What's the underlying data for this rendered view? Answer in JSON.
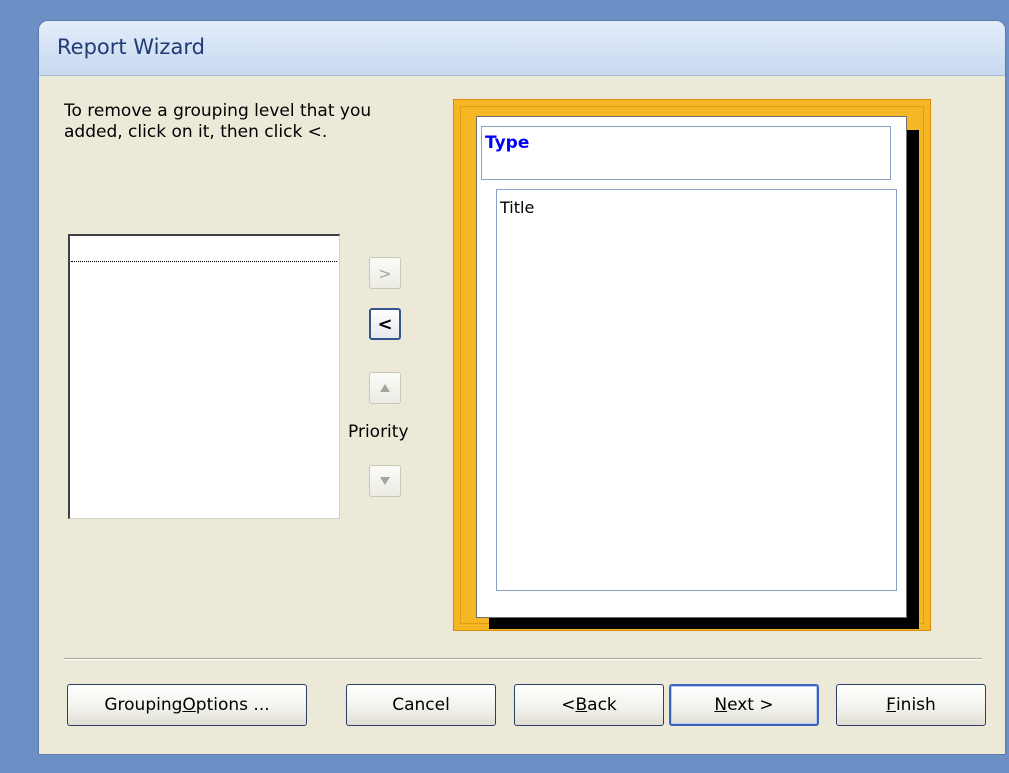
{
  "window": {
    "title": "Report Wizard"
  },
  "instruction": "To remove a grouping level that you added, click on it, then click <.",
  "grouping_list": {
    "items": []
  },
  "arrows": {
    "add": ">",
    "remove": "<",
    "up": "▲",
    "down": "▼",
    "priority_label": "Priority"
  },
  "preview": {
    "group_header": "Type",
    "detail_field": "Title"
  },
  "buttons": {
    "grouping_options": {
      "pre": "Grouping ",
      "key": "O",
      "post": "ptions ..."
    },
    "cancel": "Cancel",
    "back": {
      "pre": "< ",
      "key": "B",
      "post": "ack"
    },
    "next": {
      "pre": "",
      "key": "N",
      "post": "ext >"
    },
    "finish": {
      "pre": "",
      "key": "F",
      "post": "inish"
    }
  }
}
